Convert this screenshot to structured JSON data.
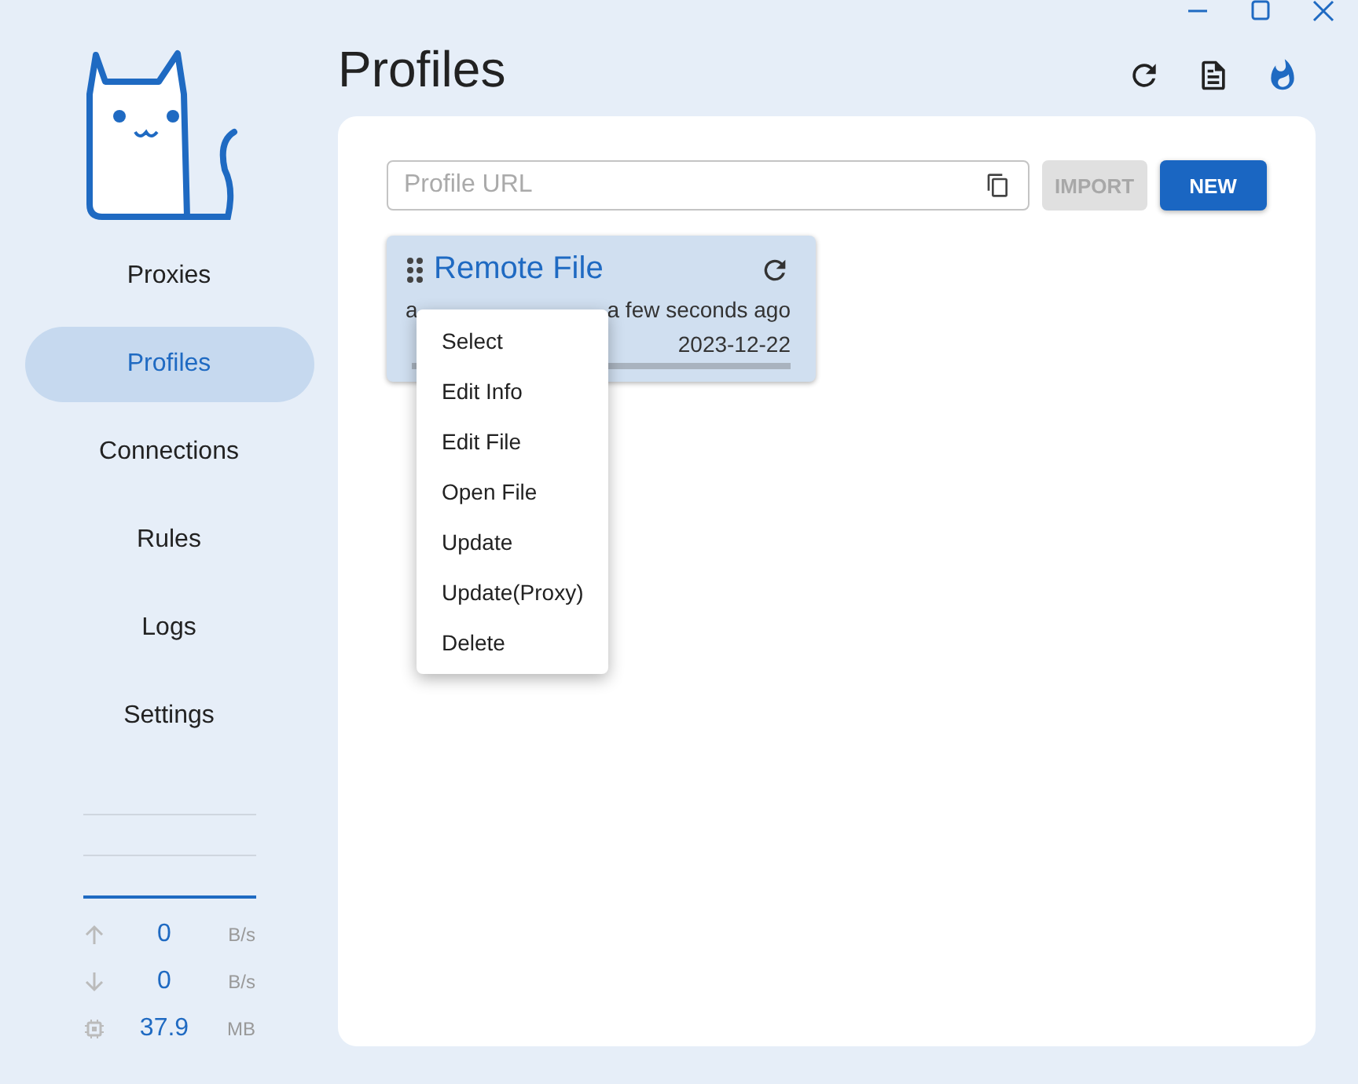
{
  "window": {
    "title": "Profiles"
  },
  "nav": [
    {
      "label": "Proxies",
      "selected": false
    },
    {
      "label": "Profiles",
      "selected": true
    },
    {
      "label": "Connections",
      "selected": false
    },
    {
      "label": "Rules",
      "selected": false
    },
    {
      "label": "Logs",
      "selected": false
    },
    {
      "label": "Settings",
      "selected": false
    }
  ],
  "traffic": [
    {
      "kind": "up",
      "value": "0",
      "unit": "B/s"
    },
    {
      "kind": "down",
      "value": "0",
      "unit": "B/s"
    },
    {
      "kind": "memory",
      "value": "37.9",
      "unit": "MB"
    }
  ],
  "toolbar": {
    "url_field": {
      "placeholder": "Profile URL"
    },
    "import_button": {
      "label": "IMPORT",
      "disabled": true
    },
    "new_button": {
      "label": "NEW"
    }
  },
  "profiles": [
    {
      "name": "Remote File",
      "selected": true,
      "url_text": "a",
      "updated": "a few seconds ago",
      "expires": "2023-12-22"
    }
  ],
  "context_menu": [
    "Select",
    "Edit Info",
    "Edit File",
    "Open File",
    "Update",
    "Update(Proxy)",
    "Delete"
  ]
}
